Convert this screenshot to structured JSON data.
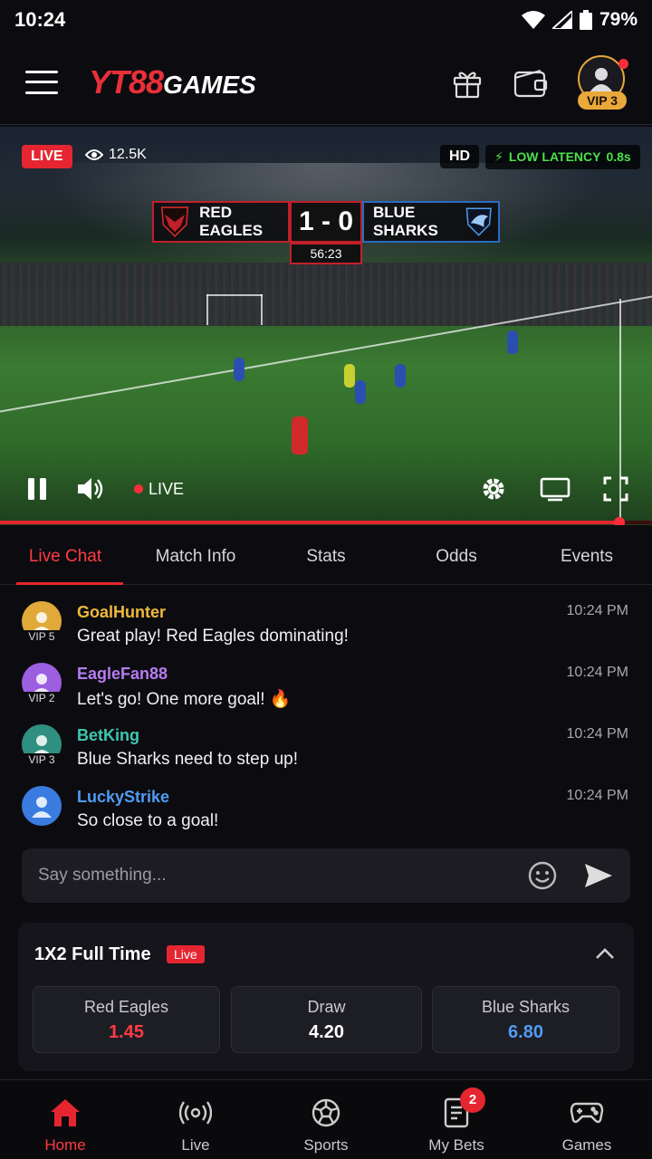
{
  "status_bar": {
    "time": "10:24",
    "battery": "79%"
  },
  "header": {
    "logo_part1": "YT88",
    "logo_part2": "GAMES",
    "vip_badge": "VIP 3"
  },
  "video": {
    "live_badge": "LIVE",
    "viewers": "12.5K",
    "quality": "HD",
    "latency_label": "LOW LATENCY",
    "latency_value": "0.8s",
    "home_team": "RED EAGLES",
    "away_team": "BLUE SHARKS",
    "score": "1 - 0",
    "clock": "56:23",
    "controls_live": "LIVE",
    "progress": 0.95
  },
  "tabs": [
    {
      "label": "Live Chat",
      "active": true
    },
    {
      "label": "Match Info"
    },
    {
      "label": "Stats"
    },
    {
      "label": "Odds"
    },
    {
      "label": "Events"
    }
  ],
  "chat": {
    "messages": [
      {
        "user": "GoalHunter",
        "vip": "VIP 5",
        "text": "Great play! Red Eagles dominating!",
        "time": "10:24 PM",
        "name_color": "#f0b93a",
        "avatar_color": "#e0a93a"
      },
      {
        "user": "EagleFan88",
        "vip": "VIP 2",
        "text": "Let's go! One more goal! 🔥",
        "time": "10:24 PM",
        "name_color": "#b67cf2",
        "avatar_color": "#9b5fe0"
      },
      {
        "user": "BetKing",
        "vip": "VIP 3",
        "text": "Blue Sharks need to step up!",
        "time": "10:24 PM",
        "name_color": "#3fc7b0",
        "avatar_color": "#2f8f80"
      },
      {
        "user": "LuckyStrike",
        "vip": "",
        "text": "So close to a goal!",
        "time": "10:24 PM",
        "name_color": "#4f9cf5",
        "avatar_color": "#3a7be0"
      }
    ],
    "input_placeholder": "Say something..."
  },
  "odds": {
    "title": "1X2 Full Time",
    "live_tag": "Live",
    "options": [
      {
        "label": "Red Eagles",
        "value": "1.45",
        "color": "#ff3b44"
      },
      {
        "label": "Draw",
        "value": "4.20",
        "color": "#ffffff"
      },
      {
        "label": "Blue Sharks",
        "value": "6.80",
        "color": "#4f9cf5"
      }
    ]
  },
  "bottom_nav": [
    {
      "label": "Home",
      "icon": "home-icon",
      "active": true
    },
    {
      "label": "Live",
      "icon": "broadcast-icon"
    },
    {
      "label": "Sports",
      "icon": "soccer-ball-icon"
    },
    {
      "label": "My Bets",
      "icon": "bet-slip-icon",
      "badge": "2"
    },
    {
      "label": "Games",
      "icon": "gamepad-icon"
    }
  ],
  "colors": {
    "accent": "#e52630",
    "gold": "#e9a83a",
    "background": "#0c0c10"
  }
}
